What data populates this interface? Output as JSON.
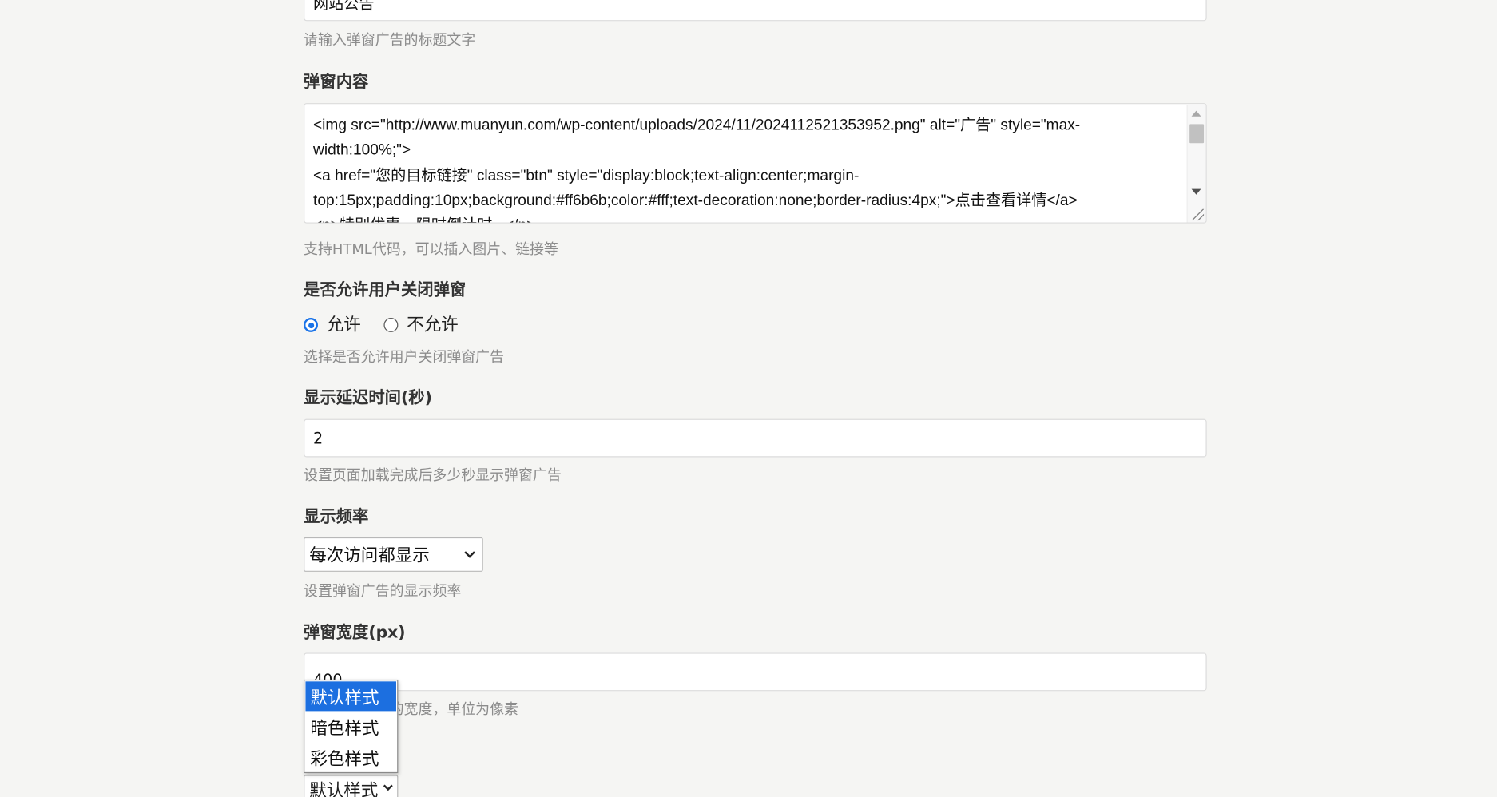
{
  "title_field": {
    "value": "网站公告",
    "hint": "请输入弹窗广告的标题文字"
  },
  "content_field": {
    "label": "弹窗内容",
    "lines": [
      "<img src=\"http://www.muanyun.com/wp-content/uploads/2024/11/2024112521353952.png\" alt=\"广告\" style=\"max-",
      "width:100%;\">",
      "<a href=\"您的目标链接\" class=\"btn\" style=\"display:block;text-align:center;margin-",
      "top:15px;padding:10px;background:#ff6b6b;color:#fff;text-decoration:none;border-radius:4px;\">点击查看详情</a>",
      "<p>特别优惠，限时倒计时...</p>"
    ],
    "hint": "支持HTML代码，可以插入图片、链接等"
  },
  "allow_close": {
    "label": "是否允许用户关闭弹窗",
    "options": [
      "允许",
      "不允许"
    ],
    "selected": "允许",
    "hint": "选择是否允许用户关闭弹窗广告"
  },
  "delay": {
    "label": "显示延迟时间(秒)",
    "value": "2",
    "hint": "设置页面加载完成后多少秒显示弹窗广告"
  },
  "frequency": {
    "label": "显示频率",
    "value": "每次访问都显示",
    "hint": "设置弹窗广告的显示频率"
  },
  "width": {
    "label": "弹窗宽度(px)",
    "value": "400",
    "hint": "设置弹窗广告的宽度，单位为像素"
  },
  "style": {
    "value": "默认样式",
    "options": [
      "默认样式",
      "暗色样式",
      "彩色样式"
    ],
    "highlighted": "默认样式"
  },
  "colors": {
    "accent": "#1a73e8",
    "highlight": "#1c6fe0",
    "hint": "#8c8c8c"
  },
  "icons": {
    "select_arrow": "chevron-down-icon",
    "resize": "resize-grip-icon"
  }
}
